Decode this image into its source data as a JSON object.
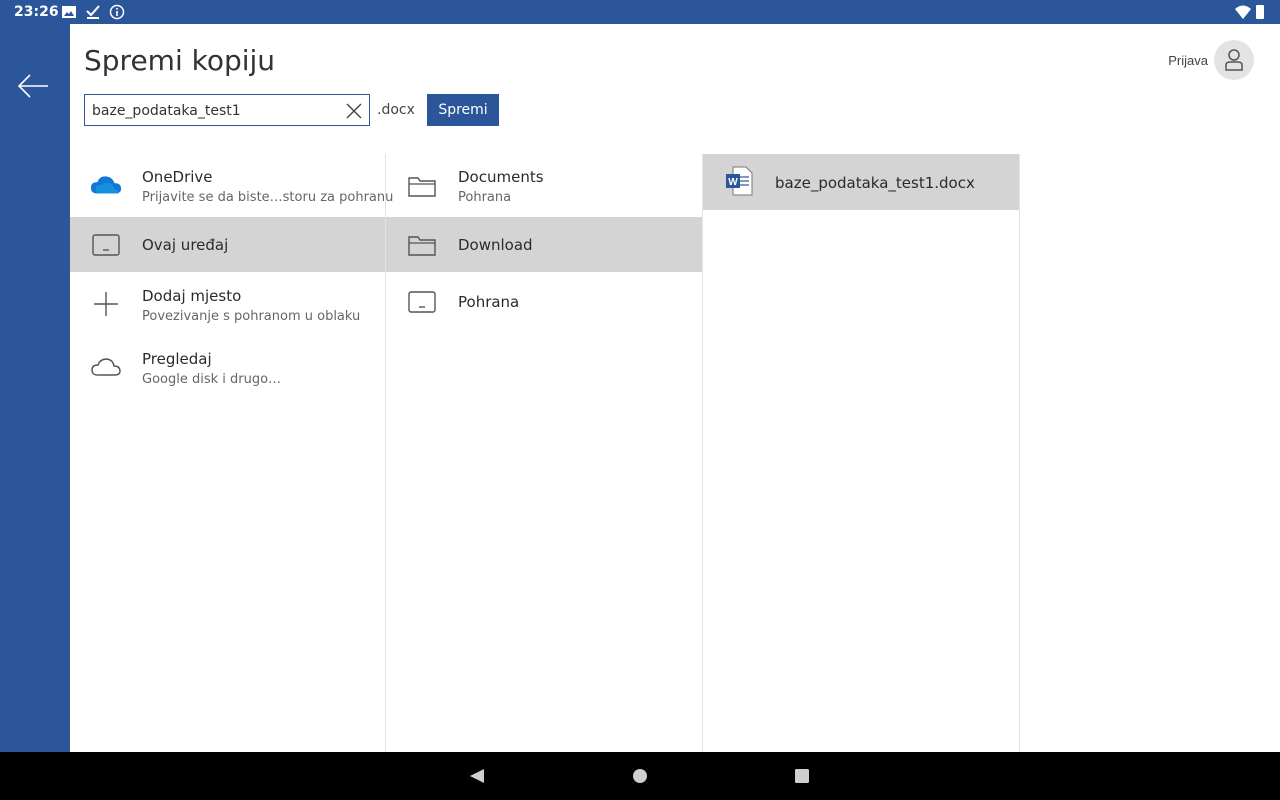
{
  "status_bar": {
    "time": "23:26",
    "icons": [
      "image-icon",
      "check-icon",
      "info-icon",
      "wifi-icon",
      "battery-icon"
    ]
  },
  "header": {
    "title": "Spremi kopiju",
    "sign_in_label": "Prijava"
  },
  "filename": {
    "value": "baze_podataka_test1",
    "extension": ".docx",
    "save_label": "Spremi"
  },
  "locations": [
    {
      "name": "OneDrive",
      "subtitle": "Prijavite se da biste…storu za pohranu",
      "icon": "onedrive-icon"
    },
    {
      "name": "Ovaj uređaj",
      "subtitle": "",
      "icon": "tablet-icon",
      "selected": true
    },
    {
      "name": "Dodaj mjesto",
      "subtitle": "Povezivanje s pohranom u oblaku",
      "icon": "plus-icon"
    },
    {
      "name": "Pregledaj",
      "subtitle": "Google disk i drugo…",
      "icon": "cloud-icon"
    }
  ],
  "folders": [
    {
      "name": "Documents",
      "subtitle": "Pohrana",
      "icon": "folder-icon"
    },
    {
      "name": "Download",
      "subtitle": "",
      "icon": "folder-icon",
      "selected": true
    },
    {
      "name": "Pohrana",
      "subtitle": "",
      "icon": "tablet-icon"
    }
  ],
  "files": [
    {
      "name": "baze_podataka_test1.docx",
      "icon": "word-doc-icon",
      "selected": true
    }
  ],
  "colors": {
    "accent": "#2b579a",
    "selection": "#d4d4d4",
    "onedrive": "#0f78d4"
  }
}
